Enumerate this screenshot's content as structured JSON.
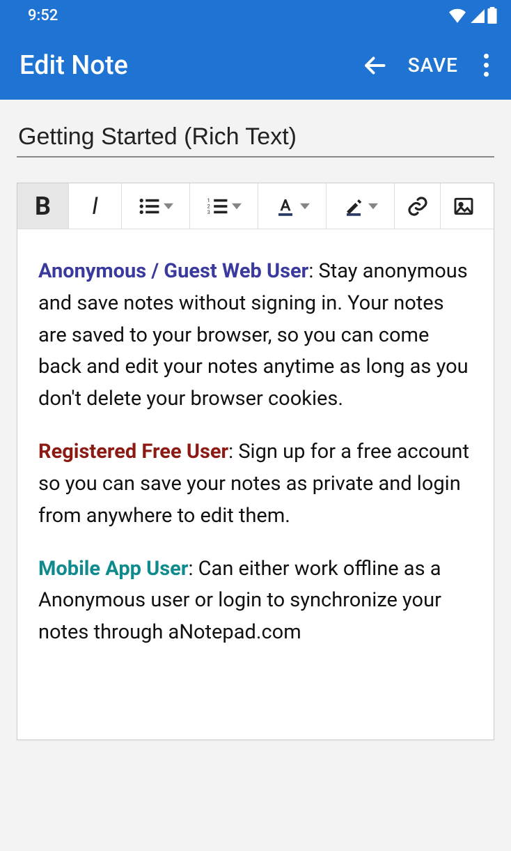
{
  "status": {
    "time": "9:52"
  },
  "appbar": {
    "title": "Edit Note",
    "save_label": "SAVE"
  },
  "note": {
    "title": "Getting Started (Rich Text)"
  },
  "toolbar": {
    "bold": "B",
    "italic": "I"
  },
  "body": {
    "p1_label": "Anonymous / Guest Web User",
    "p1_text": ": Stay anonymous and save notes without signing in. Your notes are saved to your browser, so you can come back and edit your notes anytime as long as you don't delete your browser cookies.",
    "p2_label": "Registered Free User",
    "p2_text": ": Sign up for a free account so you can save your notes as private and login from anywhere to edit them.",
    "p3_label": "Mobile App User",
    "p3_text": ": Can either work offline as a Anonymous user or login to synchronize your notes through aNotepad.com"
  }
}
